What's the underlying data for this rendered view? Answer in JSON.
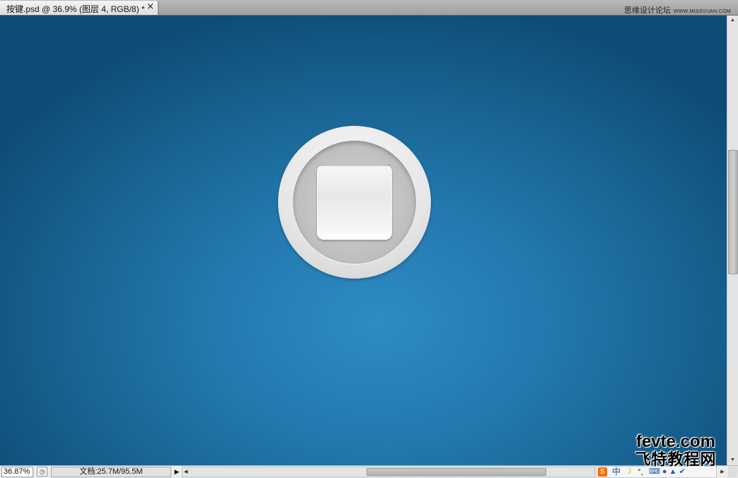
{
  "tab": {
    "title": "按键.psd @ 36.9% (图层 4, RGB/8) *",
    "close_glyph": "×"
  },
  "watermark": {
    "forum": "思缘设计论坛",
    "url": "WWW.MISSVUAN.COM"
  },
  "canvas": {
    "background_center": "#2e8cc2",
    "background_edge": "#0e4c76"
  },
  "statusbar": {
    "zoom": "36.87%",
    "doc_size": "文档:25.7M/95.5M",
    "menu_arrow": "▶",
    "left_arrow": "◀",
    "right_arrow": "▶"
  },
  "ime": {
    "logo": "S",
    "mode": "中",
    "moon": "☽",
    "punct": "°,",
    "keyboard": "⌨ ● ▲ ✔"
  },
  "site_logo": {
    "domain": "fevte.com",
    "name": "飞特教程网"
  },
  "vscroll": {
    "up": "▲",
    "down": "▼"
  }
}
